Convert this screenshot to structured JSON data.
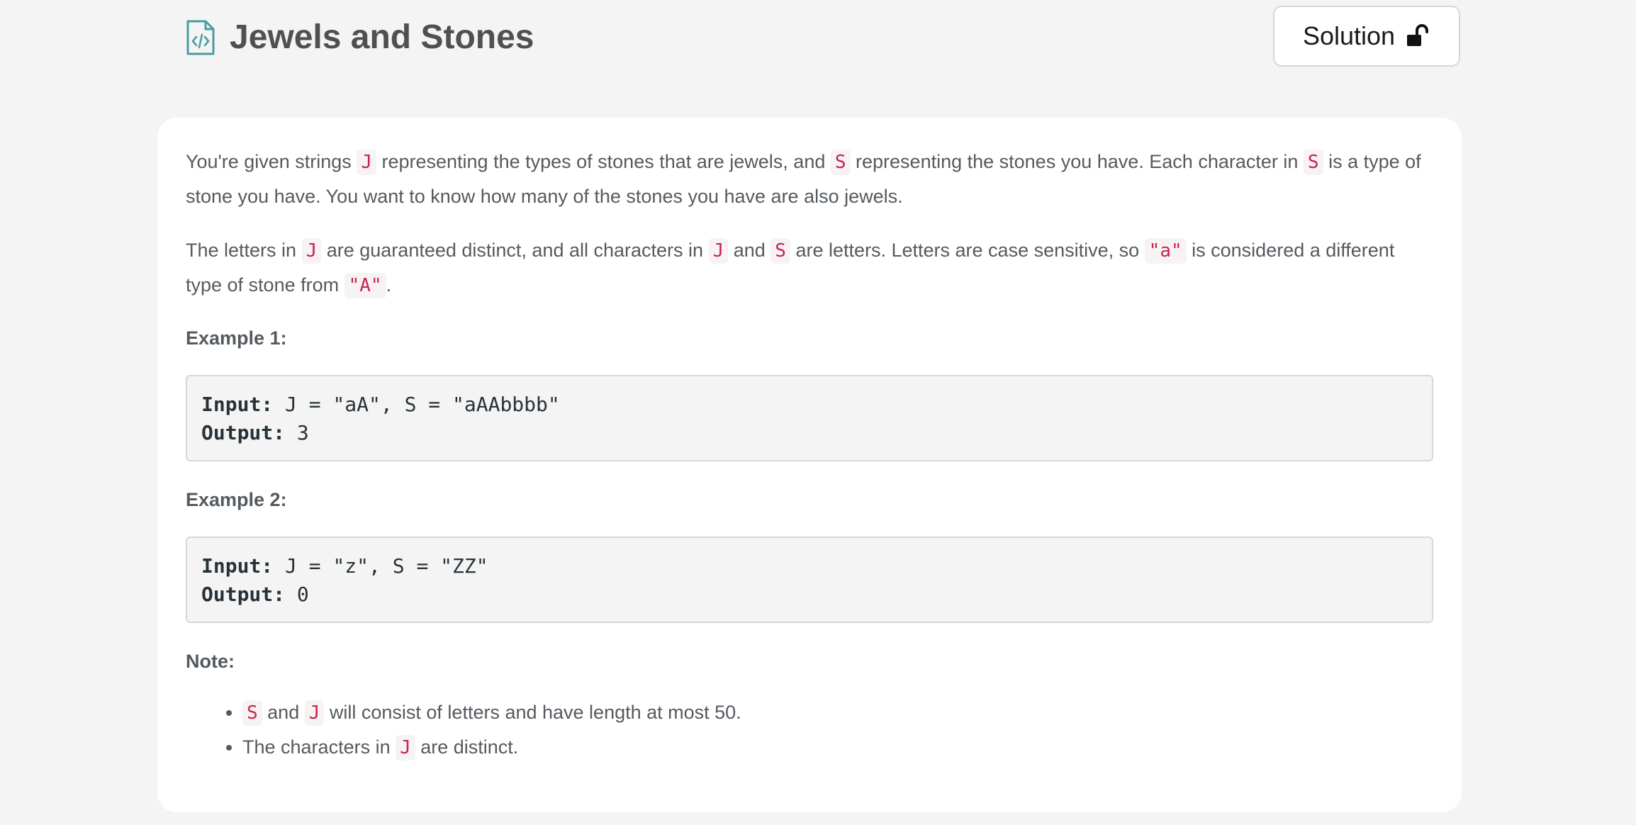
{
  "header": {
    "title": "Jewels and Stones",
    "title_icon": "code-file-icon",
    "solution_button": {
      "label": "Solution",
      "icon": "unlock-icon"
    }
  },
  "description": {
    "p1": {
      "t1": "You're given strings ",
      "c1": "J",
      "t2": " representing the types of stones that are jewels, and ",
      "c2": "S",
      "t3": " representing the stones you have.  Each character in ",
      "c3": "S",
      "t4": " is a type of stone you have.  You want to know how many of the stones you have are also jewels."
    },
    "p2": {
      "t1": "The letters in ",
      "c1": "J",
      "t2": " are guaranteed distinct, and all characters in ",
      "c2": "J",
      "t3": " and ",
      "c3": "S",
      "t4": " are letters. Letters are case sensitive, so ",
      "c4": "\"a\"",
      "t5": " is considered a different type of stone from ",
      "c5": "\"A\"",
      "t6": "."
    }
  },
  "examples": [
    {
      "heading": "Example 1:",
      "input_label": "Input:",
      "input_value": " J = \"aA\", S = \"aAAbbbb\"",
      "output_label": "Output:",
      "output_value": " 3"
    },
    {
      "heading": "Example 2:",
      "input_label": "Input:",
      "input_value": " J = \"z\", S = \"ZZ\"",
      "output_label": "Output:",
      "output_value": " 0"
    }
  ],
  "note": {
    "heading": "Note:",
    "items": [
      {
        "c1": "S",
        "t1": " and ",
        "c2": "J",
        "t2": " will consist of letters and have length at most 50."
      },
      {
        "t1": "The characters in ",
        "c1": "J",
        "t2": " are distinct."
      }
    ]
  },
  "colors": {
    "page_bg": "#f4f4f4",
    "card_bg": "#ffffff",
    "inline_code": "#c7254e",
    "icon_teal": "#4a9ca0"
  }
}
